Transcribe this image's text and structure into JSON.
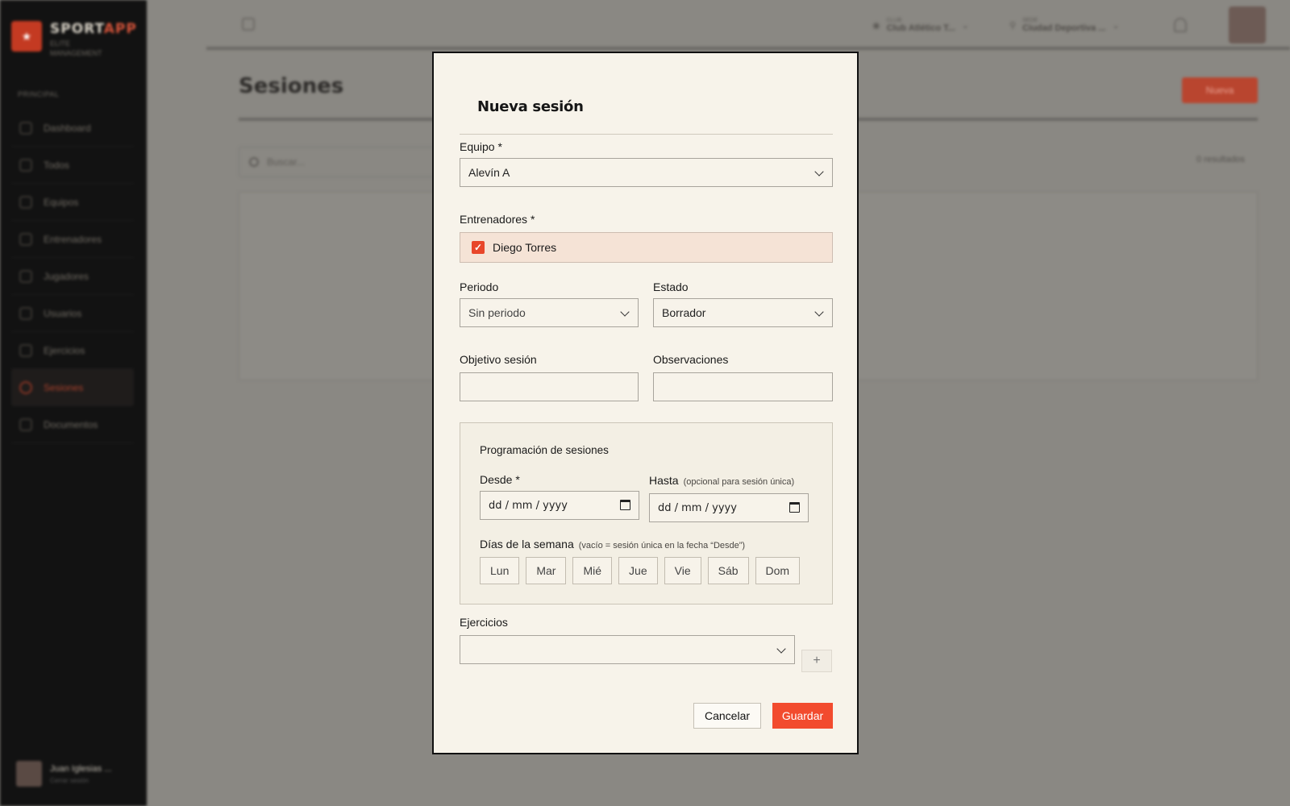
{
  "background": {
    "brand": {
      "name_a": "SPORT",
      "name_b": "APP",
      "sub_line_1": "ELITE",
      "sub_line_2": "MANAGEMENT"
    },
    "sidebar": {
      "section": "PRINCIPAL",
      "items": [
        {
          "label": "Dashboard",
          "icon": "grid-icon"
        },
        {
          "label": "Todos",
          "icon": "list-icon"
        },
        {
          "label": "Equipos",
          "icon": "team-icon"
        },
        {
          "label": "Entrenadores",
          "icon": "clipboard-icon"
        },
        {
          "label": "Jugadores",
          "icon": "player-icon"
        },
        {
          "label": "Usuarios",
          "icon": "user-icon"
        },
        {
          "label": "Ejercicios",
          "icon": "pencil-icon"
        },
        {
          "label": "Sesiones",
          "icon": "target-icon",
          "active": true
        },
        {
          "label": "Documentos",
          "icon": "document-icon"
        }
      ],
      "user": {
        "name": "Juan Iglesias ...",
        "sub": "Cerrar sesión"
      }
    },
    "topbar": {
      "club": {
        "small": "CLUB",
        "value": "Club Atlético T..."
      },
      "venue": {
        "small": "SEDE",
        "value": "Ciudad Deportiva ..."
      }
    },
    "page": {
      "title": "Sesiones",
      "new_button": "Nueva",
      "search_placeholder": "Buscar...",
      "results": "0 resultados"
    }
  },
  "modal": {
    "title": "Nueva sesión",
    "equipo": {
      "label": "Equipo *",
      "value": "Alevín A"
    },
    "entrenadores": {
      "label": "Entrenadores *",
      "coach": "Diego Torres",
      "checked": true
    },
    "periodo": {
      "label": "Periodo",
      "value": "Sin periodo"
    },
    "estado": {
      "label": "Estado",
      "value": "Borrador"
    },
    "objetivo": {
      "label": "Objetivo sesión",
      "value": ""
    },
    "observaciones": {
      "label": "Observaciones",
      "value": ""
    },
    "programacion": {
      "title": "Programación de sesiones",
      "desde": {
        "label": "Desde *",
        "placeholder": "dd / mm / yyyy"
      },
      "hasta": {
        "label": "Hasta",
        "hint": "(opcional para sesión única)",
        "placeholder": "dd / mm / yyyy"
      },
      "dias": {
        "label": "Días de la semana",
        "hint": "(vacío = sesión única en la fecha “Desde”)",
        "items": [
          "Lun",
          "Mar",
          "Mié",
          "Jue",
          "Vie",
          "Sáb",
          "Dom"
        ]
      }
    },
    "ejercicios": {
      "label": "Ejercicios",
      "value": "",
      "add": "+"
    },
    "buttons": {
      "cancel": "Cancelar",
      "save": "Guardar"
    }
  },
  "colors": {
    "accent": "#f24b2e",
    "modal_bg": "#f7f3ea",
    "coach_bg": "#f5e3d6",
    "sidebar_bg": "#121212"
  }
}
